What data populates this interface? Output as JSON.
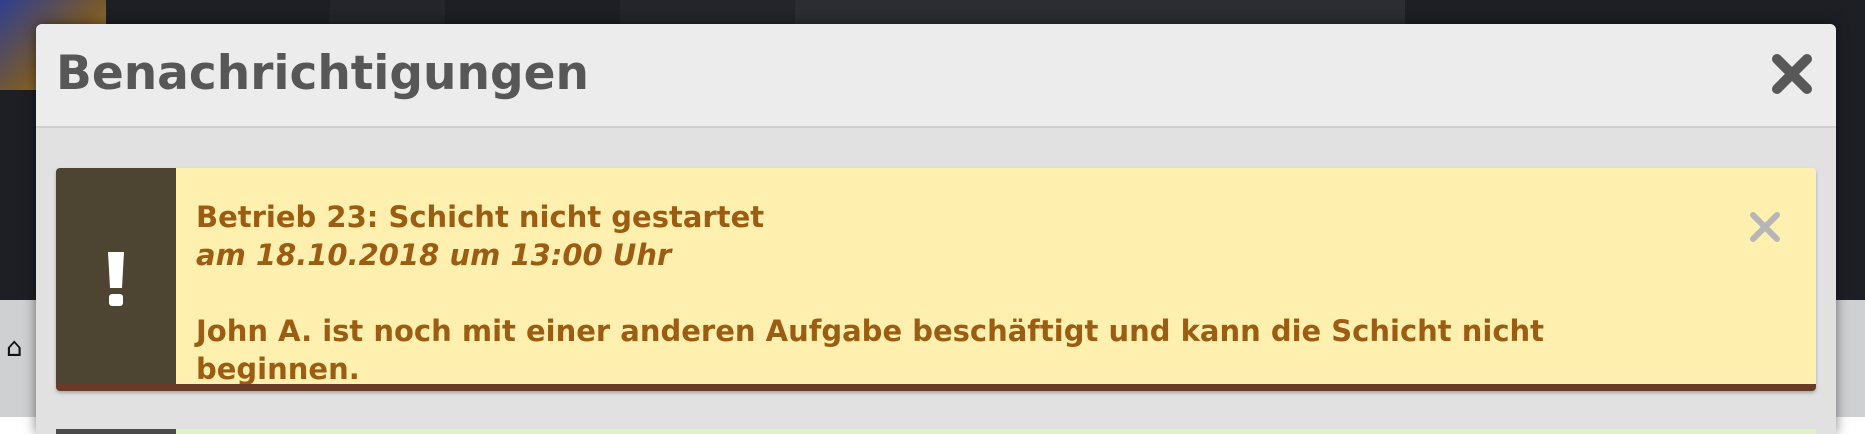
{
  "modal": {
    "title": "Benachrichtigungen",
    "close_icon": "close-icon"
  },
  "notifications": [
    {
      "title": "Betrieb 23: Schicht nicht gestartet",
      "time": "am 18.10.2018 um 13:00 Uhr",
      "message": "John A. ist noch mit einer anderen Aufgabe beschäftigt und kann die Schicht nicht beginnen.",
      "type_icon": "exclamation-icon",
      "dismiss_icon": "close-icon",
      "colors": {
        "background": "#fff0b0",
        "sidebar": "#4d4431",
        "text": "#9b5d12",
        "border": "#6b3b2a"
      }
    }
  ],
  "background_app": {
    "home_icon": "home-icon"
  }
}
